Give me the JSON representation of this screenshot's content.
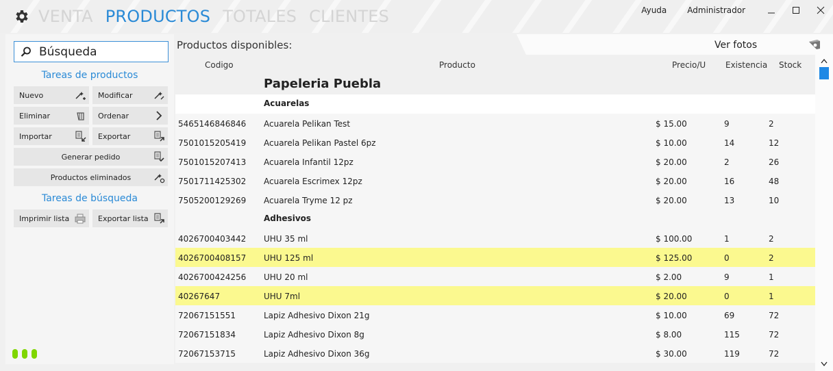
{
  "nav": {
    "tabs": [
      {
        "label": "VENTA",
        "active": false
      },
      {
        "label": "PRODUCTOS",
        "active": true
      },
      {
        "label": "TOTALES",
        "active": false
      },
      {
        "label": "CLIENTES",
        "active": false
      }
    ]
  },
  "top": {
    "help": "Ayuda",
    "admin": "Administrador"
  },
  "sidebar": {
    "search_value": "Búsqueda",
    "product_tasks_title": "Tareas de productos",
    "buttons": {
      "nuevo": "Nuevo",
      "modificar": "Modificar",
      "eliminar": "Eliminar",
      "ordenar": "Ordenar",
      "importar": "Importar",
      "exportar": "Exportar",
      "generar_pedido": "Generar pedido",
      "productos_eliminados": "Productos eliminados",
      "imprimir_lista": "Imprimir lista",
      "exportar_lista": "Exportar lista"
    },
    "search_tasks_title": "Tareas de búsqueda"
  },
  "main": {
    "title": "Productos disponibles:",
    "photos_label": "Ver fotos",
    "columns": {
      "code": "Codigo",
      "product": "Producto",
      "price": "Precio/U",
      "existence": "Existencia",
      "stock": "Stock"
    },
    "store_name": "Papeleria Puebla",
    "groups": [
      {
        "name": "Acuarelas",
        "items": [
          {
            "code": "5465146846846",
            "product": "Acuarela Pelikan Test",
            "price": "$ 15.00",
            "existence": "9",
            "stock": "2",
            "highlight": false
          },
          {
            "code": "7501015205419",
            "product": "Acuarela Pelikan Pastel 6pz",
            "price": "$ 10.00",
            "existence": "14",
            "stock": "12",
            "highlight": false
          },
          {
            "code": "7501015207413",
            "product": "Acuarela Infantil 12pz",
            "price": "$ 20.00",
            "existence": "2",
            "stock": "26",
            "highlight": false
          },
          {
            "code": "7501711425302",
            "product": "Acuarela Escrimex 12pz",
            "price": "$ 20.00",
            "existence": "16",
            "stock": "48",
            "highlight": false
          },
          {
            "code": "7505200129269",
            "product": "Acuarela Tryme 12 pz",
            "price": "$ 20.00",
            "existence": "13",
            "stock": "10",
            "highlight": false
          }
        ]
      },
      {
        "name": "Adhesivos",
        "items": [
          {
            "code": "4026700403442",
            "product": "UHU 35 ml",
            "price": "$ 100.00",
            "existence": "1",
            "stock": "2",
            "highlight": false
          },
          {
            "code": "4026700408157",
            "product": "UHU 125 ml",
            "price": "$ 125.00",
            "existence": "0",
            "stock": "2",
            "highlight": true
          },
          {
            "code": "4026700424256",
            "product": "UHU 20 ml",
            "price": "$ 2.00",
            "existence": "9",
            "stock": "1",
            "highlight": false
          },
          {
            "code": "40267647",
            "product": "UHU 7ml",
            "price": "$ 20.00",
            "existence": "0",
            "stock": "1",
            "highlight": true
          },
          {
            "code": "72067151551",
            "product": "Lapiz Adhesivo Dixon 21g",
            "price": "$ 10.00",
            "existence": "69",
            "stock": "72",
            "highlight": false
          },
          {
            "code": "72067151834",
            "product": "Lapiz Adhesivo Dixon 8g",
            "price": "$ 8.00",
            "existence": "115",
            "stock": "72",
            "highlight": false
          },
          {
            "code": "72067153715",
            "product": "Lapiz Adhesivo Dixon 36g",
            "price": "$ 30.00",
            "existence": "119",
            "stock": "72",
            "highlight": false
          }
        ]
      }
    ]
  },
  "colors": {
    "accent": "#2a8ad6",
    "highlight_row": "#fbf98f",
    "status_dots": "#7fd600"
  }
}
